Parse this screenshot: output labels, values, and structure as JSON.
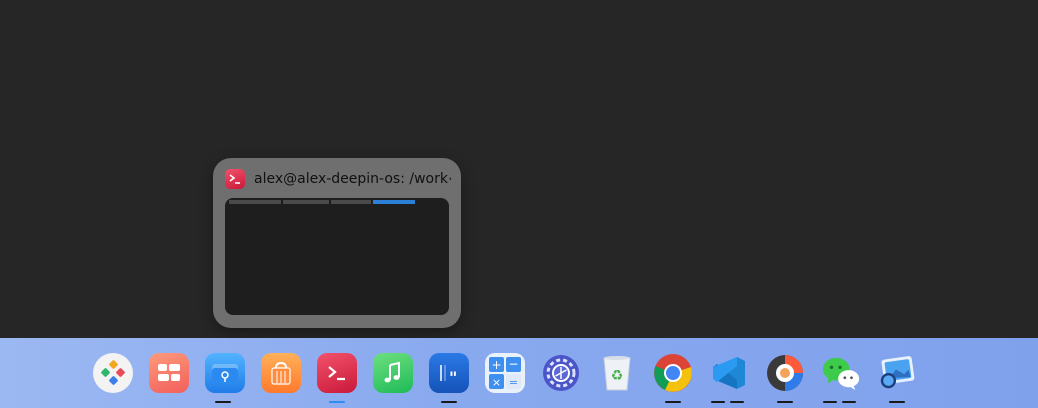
{
  "preview": {
    "title": "alex@alex-deepin-os: /work⋯",
    "app": "terminal",
    "thumbnail_tabs": 4,
    "icons": {
      "app": "terminal-icon",
      "close": "close-icon"
    }
  },
  "dock": {
    "items": [
      {
        "name": "launcher",
        "icon": "launcher-icon",
        "running": false
      },
      {
        "name": "multitasking-view",
        "icon": "multitasking-icon",
        "running": false
      },
      {
        "name": "file-manager",
        "icon": "file-manager-icon",
        "running": true
      },
      {
        "name": "app-store",
        "icon": "app-store-icon",
        "running": false
      },
      {
        "name": "terminal",
        "icon": "terminal-icon",
        "running": true,
        "active": true
      },
      {
        "name": "music",
        "icon": "music-icon",
        "running": false
      },
      {
        "name": "text-editor",
        "icon": "text-editor-icon",
        "running": true
      },
      {
        "name": "calculator",
        "icon": "calculator-icon",
        "running": false
      },
      {
        "name": "control-center",
        "icon": "settings-icon",
        "running": false
      },
      {
        "name": "trash",
        "icon": "trash-icon",
        "running": false
      },
      {
        "name": "chrome",
        "icon": "chrome-icon",
        "running": true
      },
      {
        "name": "vscode",
        "icon": "vscode-icon",
        "running": true,
        "windows": 2
      },
      {
        "name": "screen-recorder",
        "icon": "screen-recorder-icon",
        "running": true
      },
      {
        "name": "wechat",
        "icon": "wechat-icon",
        "running": true,
        "windows": 2
      },
      {
        "name": "image-viewer",
        "icon": "image-viewer-icon",
        "running": true
      }
    ]
  },
  "colors": {
    "desktop": "#262626",
    "preview_bg": "#6f6f6f",
    "dock_start": "#9bb8f2",
    "dock_end": "#7fa1ec",
    "active_indicator": "#2f8cf0"
  }
}
